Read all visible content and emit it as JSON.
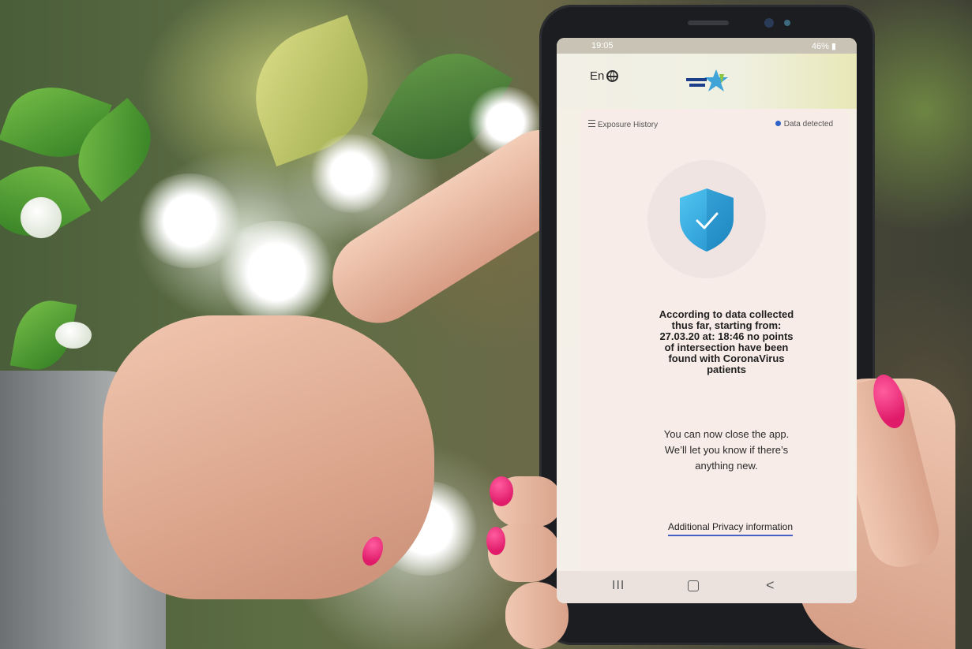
{
  "status_bar": {
    "time": "19:05",
    "indicators": "46% ▮"
  },
  "app": {
    "language_toggle": "En",
    "language_icon": "globe-icon",
    "logo_icon": "ministry-of-health-logo",
    "exposure_history_label": "Exposure History",
    "data_status": "Data detected",
    "shield_icon": "check-shield-icon",
    "message_lines": [
      "According to data collected",
      "thus far, starting from:",
      "27.03.20 at: 18:46 no points",
      "of intersection have been",
      "found with CoronaVirus",
      "patients"
    ],
    "close_lines": [
      "You can now close the app.",
      "We’ll let you know if there’s",
      "anything new."
    ],
    "privacy_link": "Additional Privacy information"
  },
  "nav_bar": {
    "recent": "III",
    "back": "<"
  },
  "colors": {
    "accent_blue": "#4561c4",
    "shield_blue": "#3aaee0",
    "nail_pink": "#e01b6a"
  }
}
